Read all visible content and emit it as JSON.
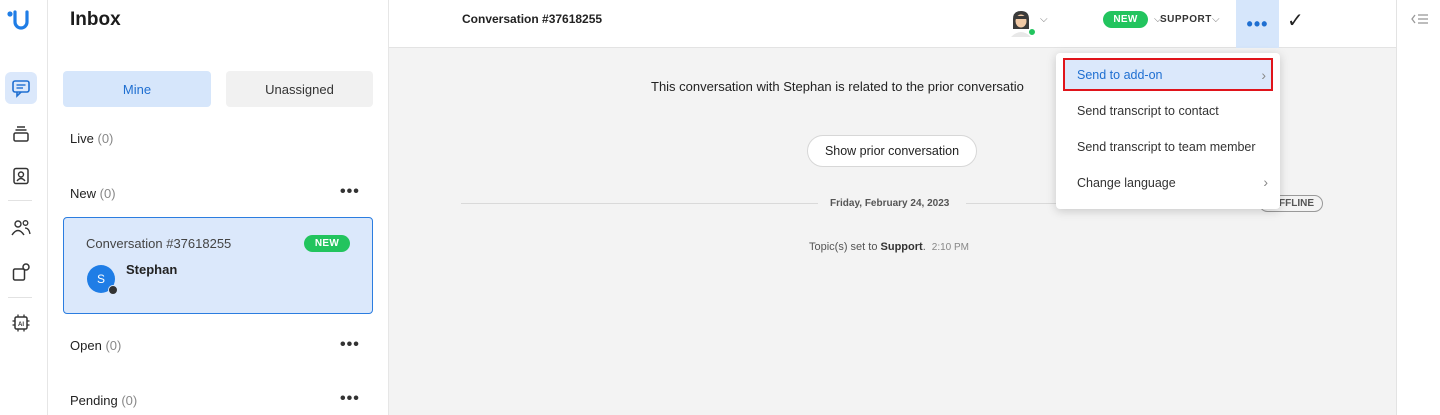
{
  "inbox": {
    "title": "Inbox",
    "tabs": {
      "mine": "Mine",
      "unassigned": "Unassigned"
    },
    "sections": {
      "live": {
        "label": "Live",
        "count": "(0)"
      },
      "new": {
        "label": "New",
        "count": "(0)"
      },
      "open": {
        "label": "Open",
        "count": "(0)"
      },
      "pending": {
        "label": "Pending",
        "count": "(0)"
      }
    },
    "more": "•••",
    "card": {
      "title": "Conversation #37618255",
      "badge": "NEW",
      "avatar_initial": "S",
      "name": "Stephan"
    }
  },
  "header": {
    "title": "Conversation #37618255",
    "status_badge": "NEW",
    "topic_dropdown": "SUPPORT",
    "more": "•••",
    "resolve": "✓"
  },
  "conversation": {
    "related_text": "This conversation with Stephan is related to the prior conversatio",
    "prior_button": "Show prior conversation",
    "date": "Friday, February 24, 2023",
    "offline_badge": "FFLINE",
    "topic_prefix": "Topic(s) set to ",
    "topic_value": "Support",
    "topic_suffix": ".",
    "time": "2:10 PM"
  },
  "menu": {
    "items": [
      {
        "label": "Send to add-on",
        "submenu": true
      },
      {
        "label": "Send transcript to contact",
        "submenu": false
      },
      {
        "label": "Send transcript to team member",
        "submenu": false
      },
      {
        "label": "Change language",
        "submenu": true
      }
    ]
  },
  "colors": {
    "accent": "#1f6fd1",
    "selection": "#dbe8fb",
    "new_badge": "#22c45e",
    "highlight_border": "#e0141b"
  }
}
